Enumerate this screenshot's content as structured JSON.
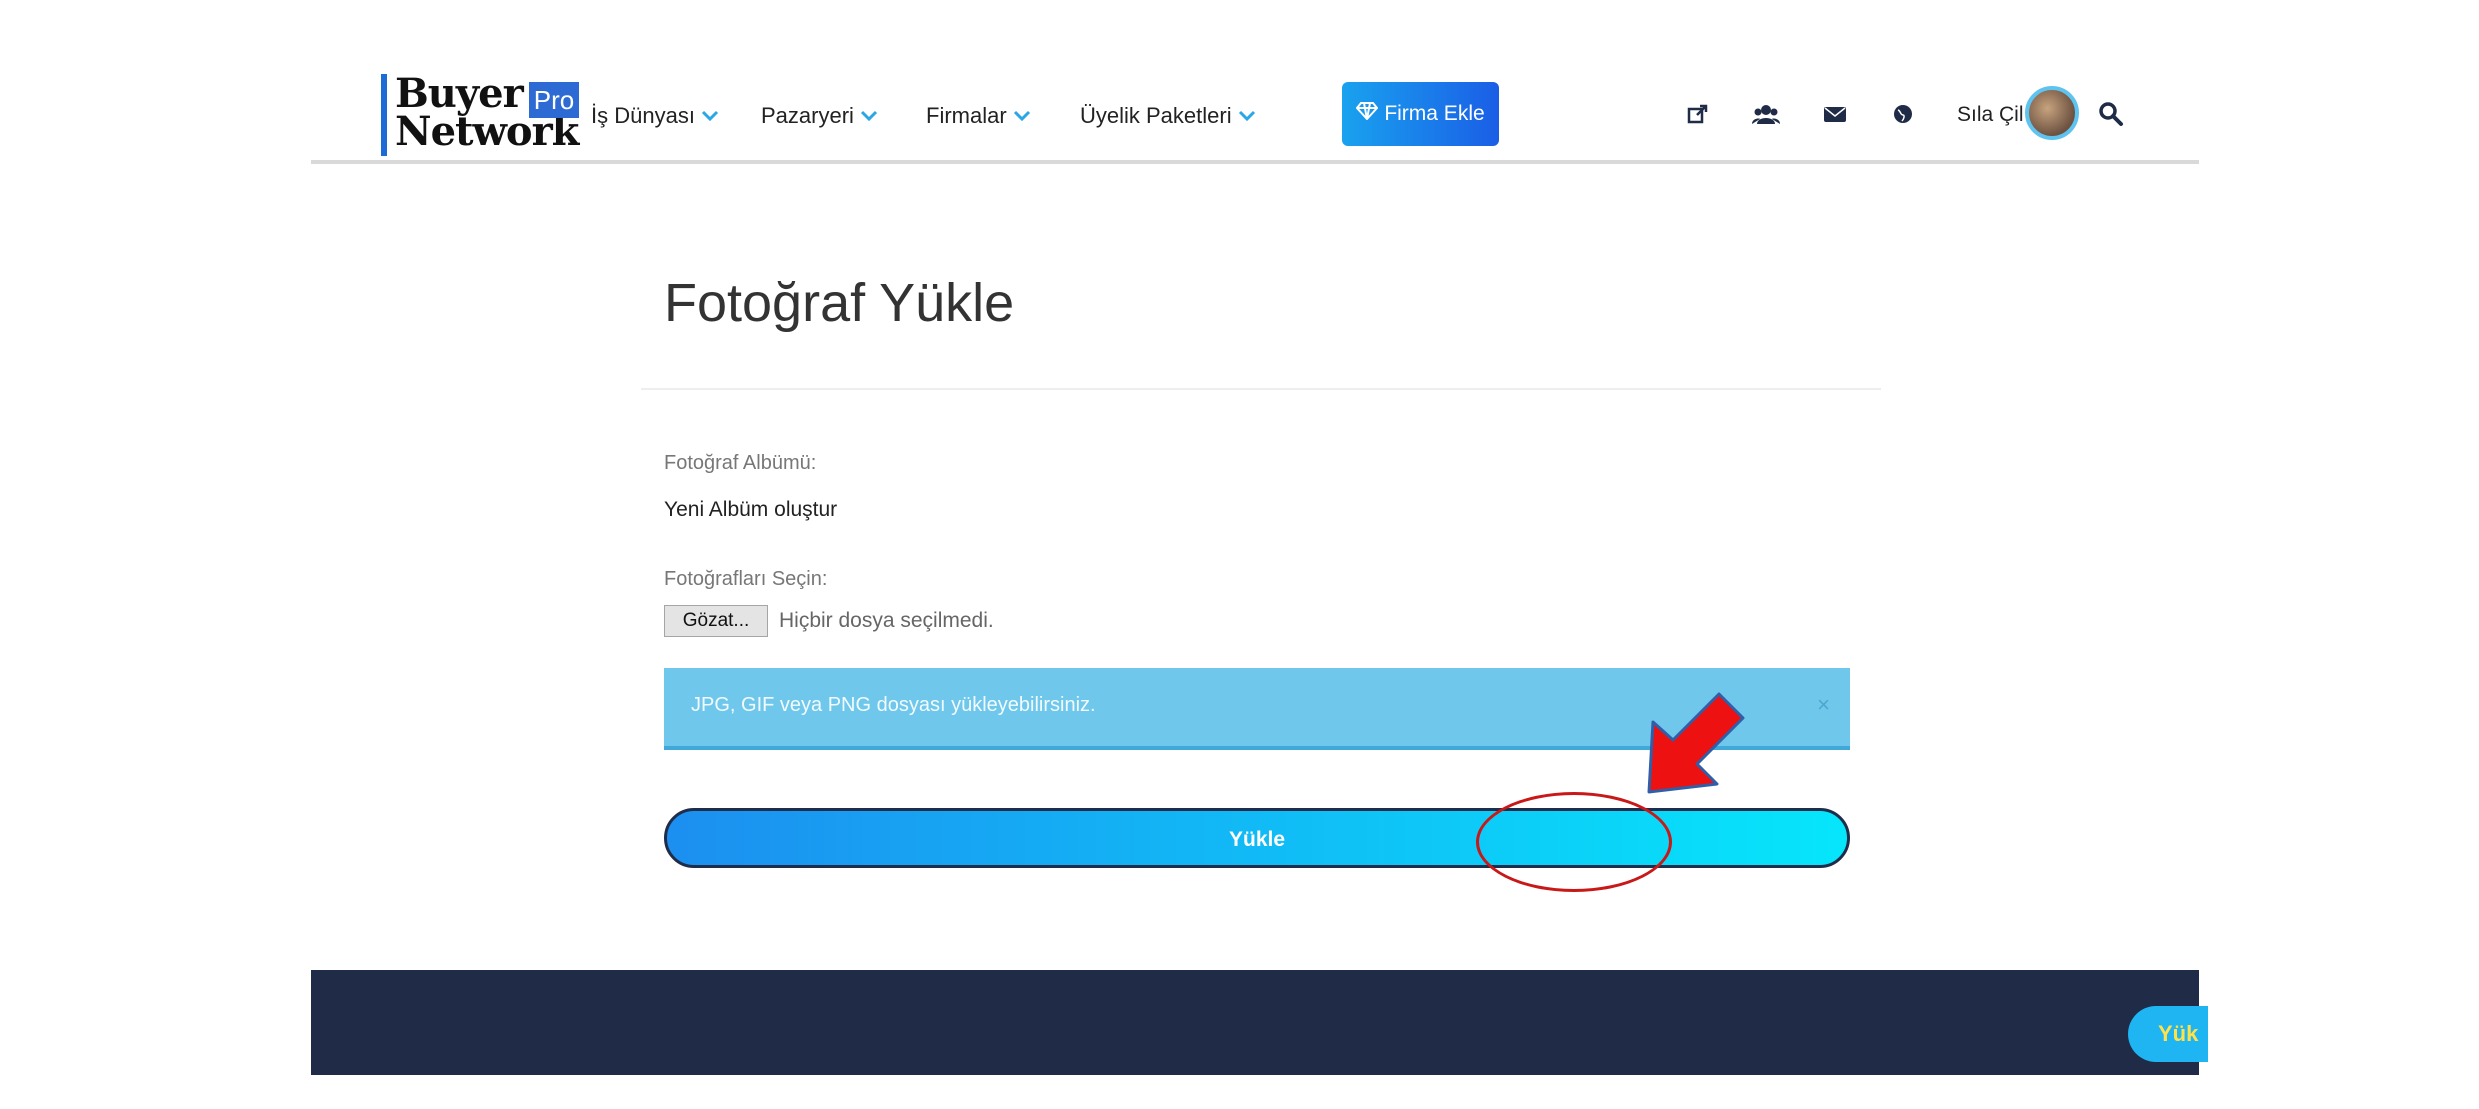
{
  "header": {
    "logo": {
      "line1": "Buyer",
      "line2": "Network",
      "badge": "Pro"
    },
    "nav": [
      {
        "label": "İş Dünyası"
      },
      {
        "label": "Pazaryeri"
      },
      {
        "label": "Firmalar"
      },
      {
        "label": "Üyelik Paketleri"
      }
    ],
    "add_company_label": "Firma Ekle",
    "icons": [
      "external-link-icon",
      "users-icon",
      "envelope-icon",
      "globe-icon",
      "search-icon"
    ],
    "user_name": "Sıla Çil"
  },
  "main": {
    "title": "Fotoğraf Yükle",
    "album_label": "Fotoğraf Albümü:",
    "album_value": "Yeni Albüm oluştur",
    "select_label": "Fotoğrafları Seçin:",
    "browse_button": "Gözat...",
    "no_file_text": "Hiçbir dosya seçilmedi.",
    "alert_text": "JPG, GIF veya PNG dosyası yükleyebilirsiniz.",
    "alert_close": "×",
    "upload_button": "Yükle"
  },
  "footer": {
    "floating_button": "Yük"
  },
  "colors": {
    "accent_blue": "#1a8ff0",
    "alert_bg": "#6fc7eb",
    "footer_bg": "#1f2b47",
    "annotation_red": "#e01010"
  }
}
